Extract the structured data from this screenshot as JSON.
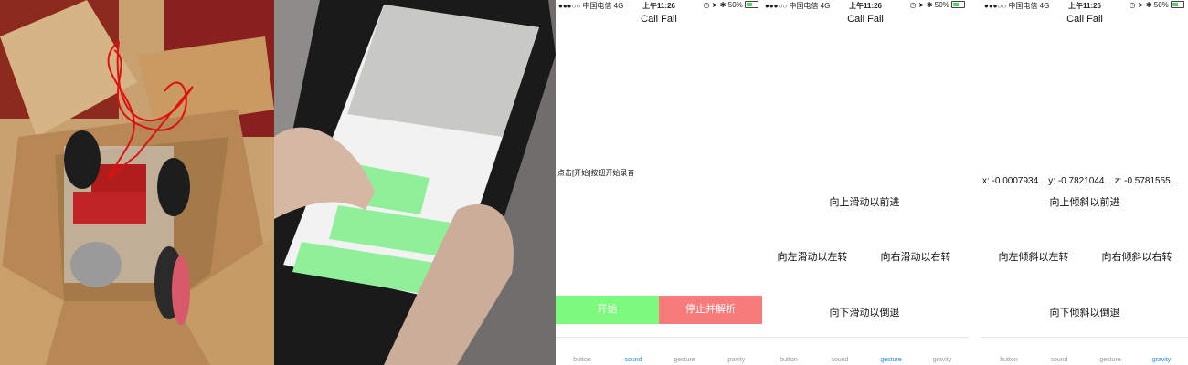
{
  "status": {
    "carrier": "●●●○○ 中国电信",
    "network": "4G",
    "time": "上午11:26",
    "battery": "50%"
  },
  "title": "Call Fail",
  "tabs": [
    "button",
    "sound",
    "gesture",
    "gravity"
  ],
  "sound_screen": {
    "hint": "点击[开始]按钮开始录音",
    "start_label": "开始",
    "stop_label": "停止并解析",
    "active_tab": "sound"
  },
  "gesture_screen": {
    "up": "向上滑动以前进",
    "left": "向左滑动以左转",
    "right": "向右滑动以右转",
    "down": "向下滑动以倒退",
    "active_tab": "gesture"
  },
  "gravity_screen": {
    "x": "x: -0.0007934...",
    "y": "y: -0.7821044...",
    "z": "z: -0.5781555...",
    "up": "向上倾斜以前进",
    "left": "向左倾斜以左转",
    "right": "向右倾斜以右转",
    "down": "向下倾斜以倒退",
    "active_tab": "gravity"
  },
  "colors": {
    "start_button": "#7dfa7d",
    "stop_button": "#f77b7b",
    "active_tab": "#1e90ff",
    "phone_green": "#90f09a"
  }
}
